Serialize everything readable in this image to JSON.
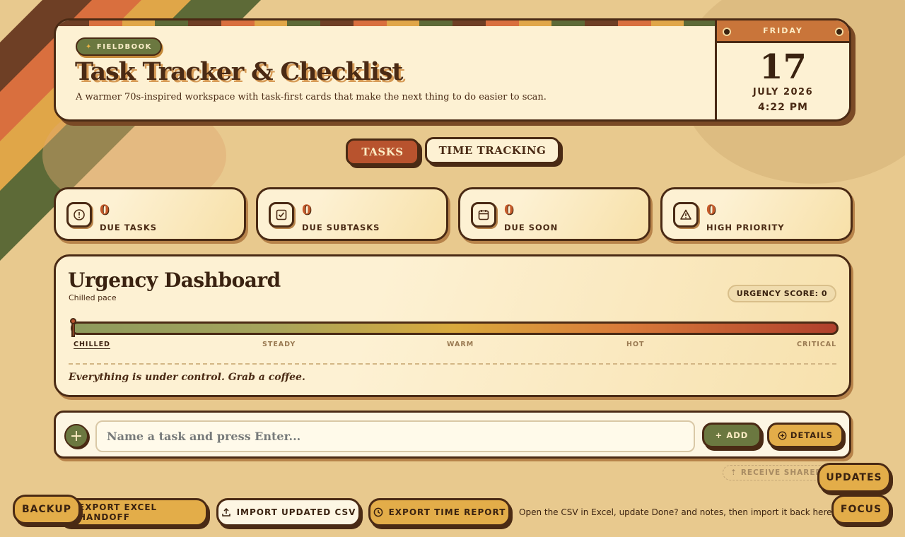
{
  "colors": {
    "brown": "#4a2a14",
    "olive": "#6b7840",
    "rust": "#b8532e",
    "mustard": "#e3ad49",
    "cream": "#fdf1d3",
    "background": "#e8c98e"
  },
  "header": {
    "badge": "FIELDBOOK",
    "badge_icon": "sparkle-icon",
    "title": "Task Tracker & Checklist",
    "subtitle": "A warmer 70s-inspired workspace with task-first cards that make the next thing to do easier to scan."
  },
  "calendar": {
    "weekday": "FRIDAY",
    "day": "17",
    "month_year": "JULY 2026",
    "time": "4:22 PM"
  },
  "tabs": [
    {
      "label": "TASKS",
      "active": true
    },
    {
      "label": "TIME TRACKING",
      "active": false
    }
  ],
  "stats": [
    {
      "value": "0",
      "label": "DUE TASKS",
      "icon": "alert-circle-icon"
    },
    {
      "value": "0",
      "label": "DUE SUBTASKS",
      "icon": "checkbox-icon"
    },
    {
      "value": "0",
      "label": "DUE SOON",
      "icon": "calendar-icon"
    },
    {
      "value": "0",
      "label": "HIGH PRIORITY",
      "icon": "warning-triangle-icon"
    }
  ],
  "urgency": {
    "title": "Urgency Dashboard",
    "status": "Chilled pace",
    "score_label": "URGENCY SCORE: 0",
    "score": 0,
    "levels": [
      "CHILLED",
      "STEADY",
      "WARM",
      "HOT",
      "CRITICAL"
    ],
    "active_level": "CHILLED",
    "message": "Everything is under control. Grab a coffee."
  },
  "entry": {
    "placeholder": "Name a task and press Enter...",
    "value": "",
    "add_label": "ADD",
    "details_label": "DETAILS"
  },
  "footer": {
    "receive_shared": "RECEIVE SHARED",
    "updates": "UPDATES",
    "backup": "BACKUP",
    "focus": "FOCUS",
    "export_excel": "EXPORT EXCEL HANDOFF",
    "import_csv": "IMPORT UPDATED CSV",
    "export_time": "EXPORT TIME REPORT",
    "hint": "Open the CSV in Excel, update Done? and notes, then import it back here."
  }
}
